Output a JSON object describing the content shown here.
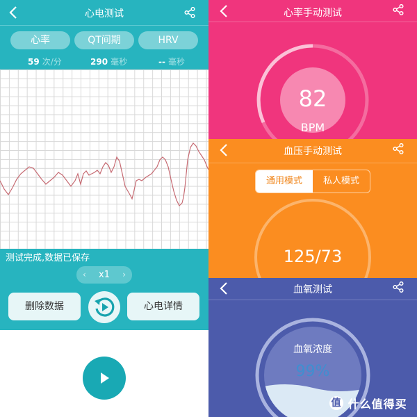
{
  "ecg": {
    "title": "心电测试",
    "metrics": [
      {
        "label": "心率",
        "value": "59",
        "unit": "次/分"
      },
      {
        "label": "QT间期",
        "value": "290",
        "unit": "毫秒"
      },
      {
        "label": "HRV",
        "value": "--",
        "unit": "毫秒"
      }
    ],
    "status_text": "测试完成,数据已保存",
    "zoom": {
      "value": "x1",
      "prev": "‹",
      "next": "›"
    },
    "delete_label": "删除数据",
    "detail_label": "心电详情"
  },
  "heart_rate": {
    "title": "心率手动测试",
    "value": "82",
    "unit": "BPM"
  },
  "blood_pressure": {
    "title": "血压手动测试",
    "tabs": [
      "通用模式",
      "私人模式"
    ],
    "active_tab": 0,
    "value": "125/73"
  },
  "blood_oxygen": {
    "title": "血氧测试",
    "label": "血氧浓度",
    "value": "99%",
    "fill_level": 0.99
  },
  "watermark": {
    "text": "什么值得买"
  },
  "colors": {
    "teal": "#27b4bf",
    "pink": "#f0357d",
    "orange": "#fb8d20",
    "indigo": "#4c5bab"
  }
}
